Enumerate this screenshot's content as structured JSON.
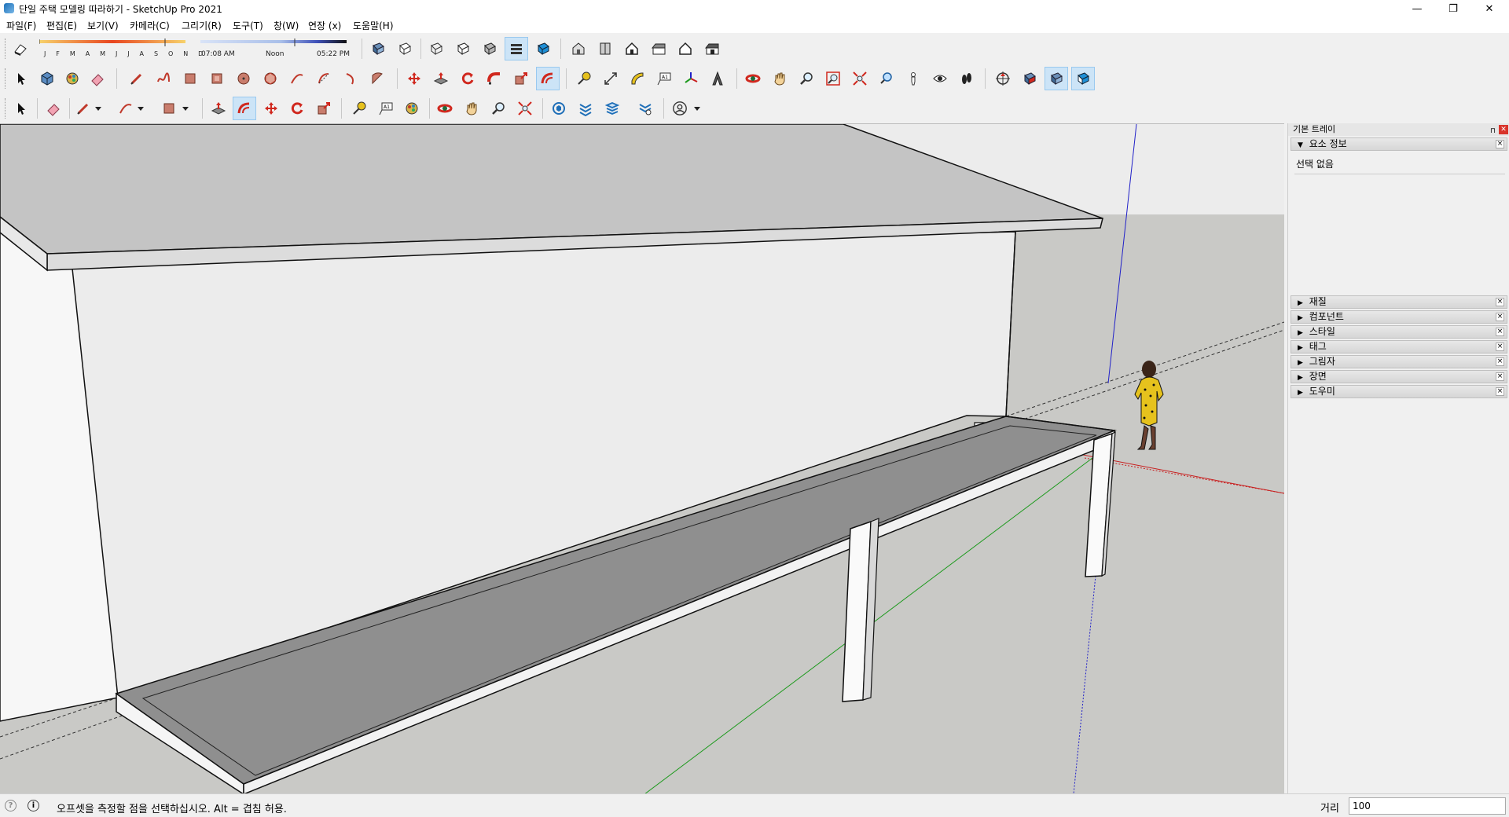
{
  "window": {
    "title": "단일 주택 모델링 따라하기 - SketchUp Pro 2021",
    "minimize": "—",
    "restore": "❐",
    "close": "✕"
  },
  "menu": [
    "파일(F)",
    "편집(E)",
    "보기(V)",
    "카메라(C)",
    "그리기(R)",
    "도구(T)",
    "창(W)",
    "연장 (x)",
    "도움말(H)"
  ],
  "shadows": {
    "months": "J F M A M J J A S O N D",
    "time_start": "07:08 AM",
    "time_mid": "Noon",
    "time_end": "05:22 PM"
  },
  "tray": {
    "title": "기본 트레이",
    "pin": "⊓",
    "close": "✕",
    "entity_info": {
      "label": "요소 정보",
      "arrow": "▼",
      "content": "선택 없음"
    },
    "panels": [
      {
        "label": "재질",
        "arrow": "▶"
      },
      {
        "label": "컴포넌트",
        "arrow": "▶"
      },
      {
        "label": "스타일",
        "arrow": "▶"
      },
      {
        "label": "태그",
        "arrow": "▶"
      },
      {
        "label": "그림자",
        "arrow": "▶"
      },
      {
        "label": "장면",
        "arrow": "▶"
      },
      {
        "label": "도우미",
        "arrow": "▶"
      }
    ],
    "panel_close": "×"
  },
  "status": {
    "message": "오프셋을 측정할 점을 선택하십시오. Alt = 겹침 허용.",
    "geo_icon": "?",
    "info_icon": "i",
    "vcb_label": "거리",
    "vcb_value": "100"
  },
  "colors": {
    "accent_red": "#d0281e",
    "axis_blue": "#2020c8",
    "axis_red": "#c81e1e",
    "axis_green": "#1e9a1e",
    "ground": "#c9c9c6",
    "sky": "#e9e9e9"
  }
}
